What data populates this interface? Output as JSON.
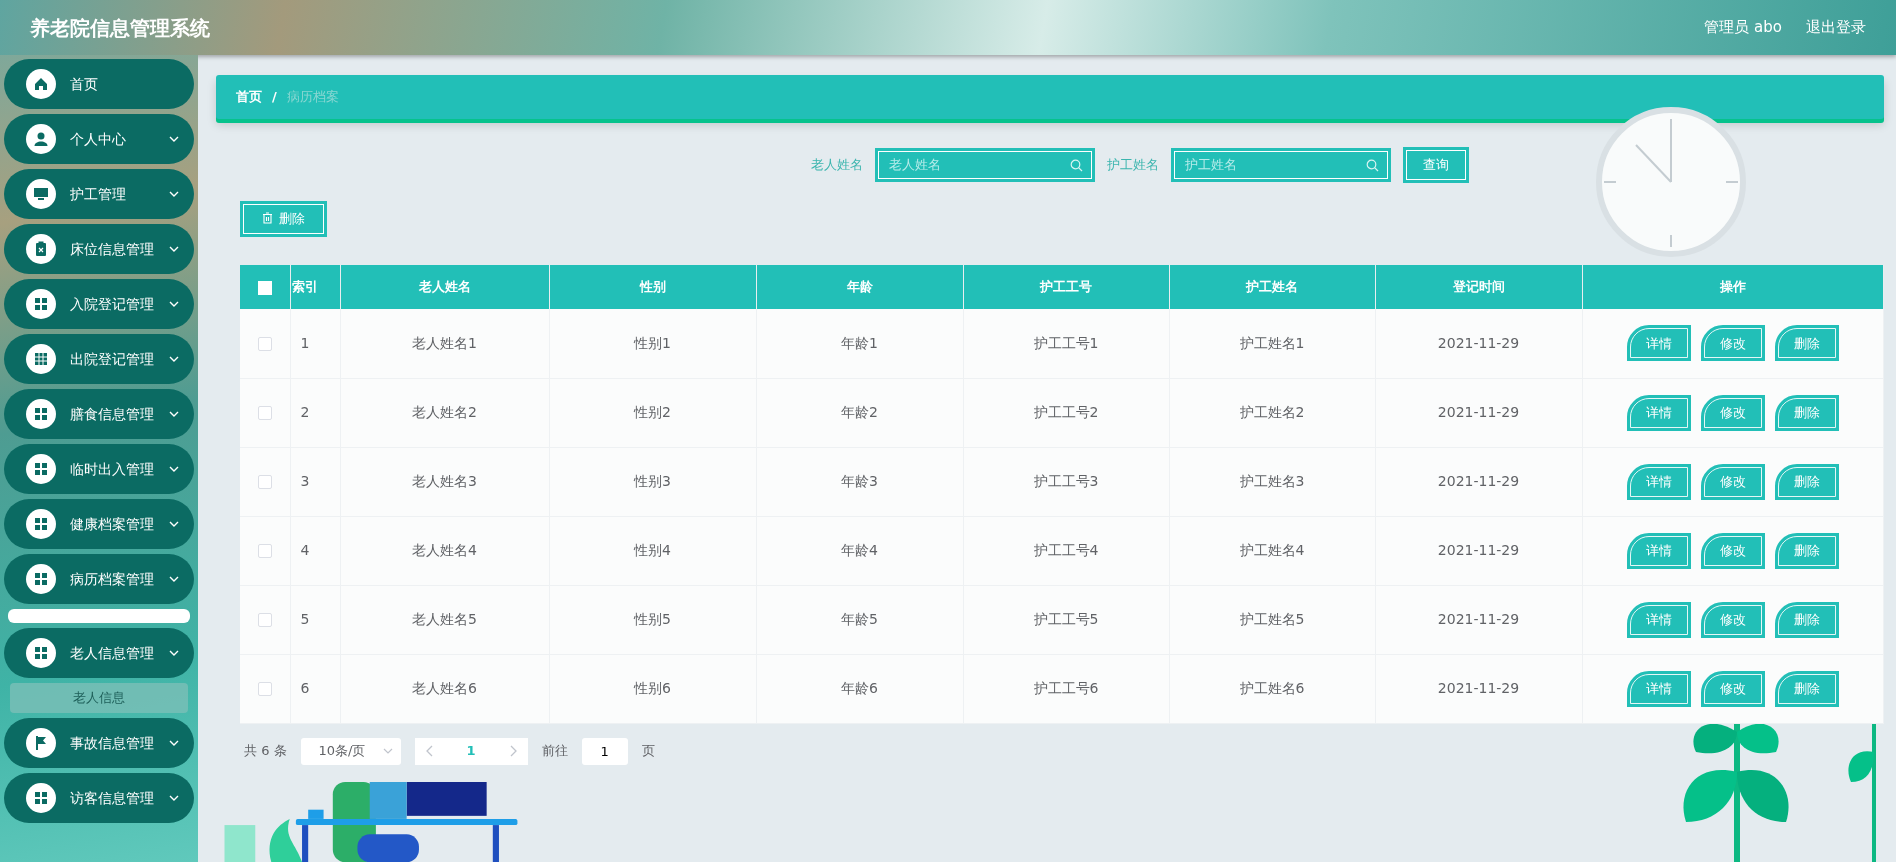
{
  "header": {
    "title": "养老院信息管理系统",
    "user": "管理员 abo",
    "logout": "退出登录"
  },
  "sidebar": {
    "items": [
      {
        "label": "首页",
        "has_arrow": false,
        "expanded": false
      },
      {
        "label": "个人中心",
        "has_arrow": true,
        "expanded": false
      },
      {
        "label": "护工管理",
        "has_arrow": true,
        "expanded": false
      },
      {
        "label": "床位信息管理",
        "has_arrow": true,
        "expanded": false
      },
      {
        "label": "入院登记管理",
        "has_arrow": true,
        "expanded": false
      },
      {
        "label": "出院登记管理",
        "has_arrow": true,
        "expanded": false
      },
      {
        "label": "膳食信息管理",
        "has_arrow": true,
        "expanded": false
      },
      {
        "label": "临时出入管理",
        "has_arrow": true,
        "expanded": false
      },
      {
        "label": "健康档案管理",
        "has_arrow": true,
        "expanded": false
      },
      {
        "label": "病历档案管理",
        "has_arrow": true,
        "expanded": true
      },
      {
        "label": "老人信息管理",
        "has_arrow": true,
        "expanded": true,
        "children": [
          {
            "label": "老人信息",
            "hovered": true
          }
        ]
      },
      {
        "label": "事故信息管理",
        "has_arrow": true,
        "expanded": false
      },
      {
        "label": "访客信息管理",
        "has_arrow": true,
        "expanded": false
      }
    ]
  },
  "breadcrumb": [
    {
      "label": "首页",
      "current": false
    },
    {
      "label": "病历档案",
      "current": true
    }
  ],
  "breadcrumb_separator": "/",
  "search": {
    "fields": [
      {
        "label": "老人姓名",
        "placeholder": "老人姓名"
      },
      {
        "label": "护工姓名",
        "placeholder": "护工姓名"
      }
    ],
    "button": "查询"
  },
  "delete_button": "删除",
  "table": {
    "header_checked": false,
    "columns": [
      "索引",
      "老人姓名",
      "性别",
      "年龄",
      "护工工号",
      "护工姓名",
      "登记时间",
      "操作"
    ],
    "rows": [
      {
        "checked": false,
        "cells": [
          "1",
          "老人姓名1",
          "性别1",
          "年龄1",
          "护工工号1",
          "护工姓名1",
          "2021-11-29"
        ],
        "actions": [
          "详情",
          "修改",
          "删除"
        ]
      },
      {
        "checked": false,
        "cells": [
          "2",
          "老人姓名2",
          "性别2",
          "年龄2",
          "护工工号2",
          "护工姓名2",
          "2021-11-29"
        ],
        "actions": [
          "详情",
          "修改",
          "删除"
        ]
      },
      {
        "checked": false,
        "cells": [
          "3",
          "老人姓名3",
          "性别3",
          "年龄3",
          "护工工号3",
          "护工姓名3",
          "2021-11-29"
        ],
        "actions": [
          "详情",
          "修改",
          "删除"
        ]
      },
      {
        "checked": false,
        "cells": [
          "4",
          "老人姓名4",
          "性别4",
          "年龄4",
          "护工工号4",
          "护工姓名4",
          "2021-11-29"
        ],
        "actions": [
          "详情",
          "修改",
          "删除"
        ]
      },
      {
        "checked": false,
        "cells": [
          "5",
          "老人姓名5",
          "性别5",
          "年龄5",
          "护工工号5",
          "护工姓名5",
          "2021-11-29"
        ],
        "actions": [
          "详情",
          "修改",
          "删除"
        ]
      },
      {
        "checked": false,
        "cells": [
          "6",
          "老人姓名6",
          "性别6",
          "年龄6",
          "护工工号6",
          "护工姓名6",
          "2021-11-29"
        ],
        "actions": [
          "详情",
          "修改",
          "删除"
        ]
      }
    ]
  },
  "pagination": {
    "total": "共 6 条",
    "page_size": "10条/页",
    "pages": [
      {
        "label": "1",
        "selected": true
      }
    ],
    "goto_label": "前往",
    "goto_value": "1",
    "goto_suffix": "页"
  }
}
